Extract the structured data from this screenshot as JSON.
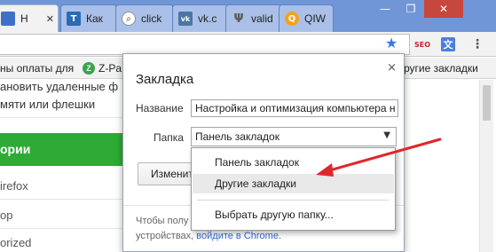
{
  "tabs": [
    {
      "title": "Н",
      "favicon": "blue-square-icon",
      "color": "#3f6fc9"
    },
    {
      "title": "Как",
      "favicon": "T",
      "color": "#2b6ab5"
    },
    {
      "title": "click",
      "favicon": "search-icon",
      "color": "#8e8e8e"
    },
    {
      "title": "vk.c",
      "favicon": "vk",
      "color": "#4c75a3"
    },
    {
      "title": "valid",
      "favicon": "antlers-icon",
      "color": "#6b6b6b"
    },
    {
      "title": "QIW",
      "favicon": "Q",
      "color": "#f5a21b"
    }
  ],
  "window_controls": {
    "min": "—",
    "max": "❐",
    "close": "✕"
  },
  "toolbar": {
    "seo_label": "SEO",
    "translate_label": "文",
    "menu_label": "⋮",
    "star": "★"
  },
  "bookmarks_bar": {
    "item1": "ны оплаты для",
    "item2_icon": "Z",
    "item2": "Z-Pa",
    "item3": "ругие закладки"
  },
  "page": {
    "line1": "ановить удаленные ф",
    "line2": "мяти или флешки",
    "category": "ории",
    "link1": "irefox",
    "link2": "op",
    "link3": "orized"
  },
  "dialog": {
    "title": "Закладка",
    "close": "×",
    "name_label": "Название",
    "name_value": "Настройка и оптимизация компьютера н",
    "folder_label": "Папка",
    "folder_value": "Панель закладок",
    "edit_button": "Изменить",
    "sync_text": "Чтобы полу",
    "sync_text2": "устройствах,",
    "sync_link": "войдите в Chrome",
    "sync_end": "."
  },
  "dropdown": {
    "items": [
      "Панель закладок",
      "Другие закладки",
      "Выбрать другую папку..."
    ],
    "selected_index": 1
  },
  "colors": {
    "arrow": "#e0262d",
    "green": "#2eab36",
    "accent": "#3b78e7"
  }
}
